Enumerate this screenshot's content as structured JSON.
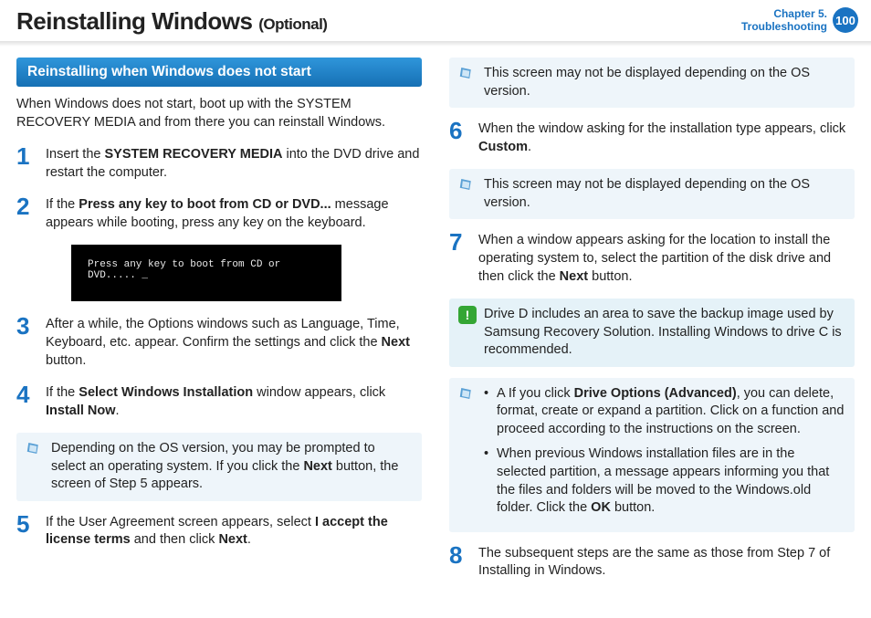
{
  "header": {
    "title": "Reinstalling Windows",
    "optional_suffix": "(Optional)",
    "chapter_line1": "Chapter 5.",
    "chapter_line2": "Troubleshooting",
    "page_number": "100"
  },
  "section_title": "Reinstalling when Windows does not start",
  "intro": "When Windows does not start, boot up with the SYSTEM RECOVERY MEDIA and from there you can reinstall Windows.",
  "steps": {
    "s1_a": "Insert the ",
    "s1_b": "SYSTEM RECOVERY MEDIA",
    "s1_c": " into the DVD drive and restart the computer.",
    "s2_a": "If the ",
    "s2_b": "Press any key to boot from CD or DVD...",
    "s2_c": " message appears while booting, press any key on the keyboard.",
    "bootmsg": "Press any key to boot from CD or DVD..... _",
    "s3_a": "After a while, the Options windows such as Language, Time, Keyboard, etc. appear. Confirm the settings and click the ",
    "s3_b": "Next",
    "s3_c": " button.",
    "s4_a": "If the ",
    "s4_b": "Select Windows Installation",
    "s4_c": " window appears, click ",
    "s4_d": "Install Now",
    "s4_e": ".",
    "note4_a": "Depending on the OS version, you may be prompted to select an operating system. If you click the ",
    "note4_b": "Next",
    "note4_c": " button, the screen of Step 5 appears.",
    "s5_a": "If the User Agreement screen appears, select ",
    "s5_b": "I accept the license terms",
    "s5_c": " and then click ",
    "s5_d": "Next",
    "s5_e": ".",
    "note_top_right": "This screen may not be displayed depending on the OS version.",
    "s6_a": "When the window asking for the installation type appears, click ",
    "s6_b": "Custom",
    "s6_c": ".",
    "note6": "This screen may not be displayed depending on the OS version.",
    "s7_a": "When a window appears asking for the location to install the operating system to, select the partition of the disk drive and then click the ",
    "s7_b": "Next",
    "s7_c": " button.",
    "warn7": "Drive D includes an area to save the backup image used by Samsung Recovery Solution. Installing Windows to drive C is recommended.",
    "bul1_a": "A If you click ",
    "bul1_b": "Drive Options (Advanced)",
    "bul1_c": ", you can delete, format, create or expand a partition. Click on a function and proceed according to the instructions on the screen.",
    "bul2_a": "When previous Windows installation files are in the selected partition, a message appears informing you that the files and folders will be moved to the Windows.old folder. Click the ",
    "bul2_b": "OK",
    "bul2_c": " button.",
    "s8": "The subsequent steps are the same as those from Step 7 of Installing in Windows."
  },
  "nums": {
    "n1": "1",
    "n2": "2",
    "n3": "3",
    "n4": "4",
    "n5": "5",
    "n6": "6",
    "n7": "7",
    "n8": "8"
  }
}
